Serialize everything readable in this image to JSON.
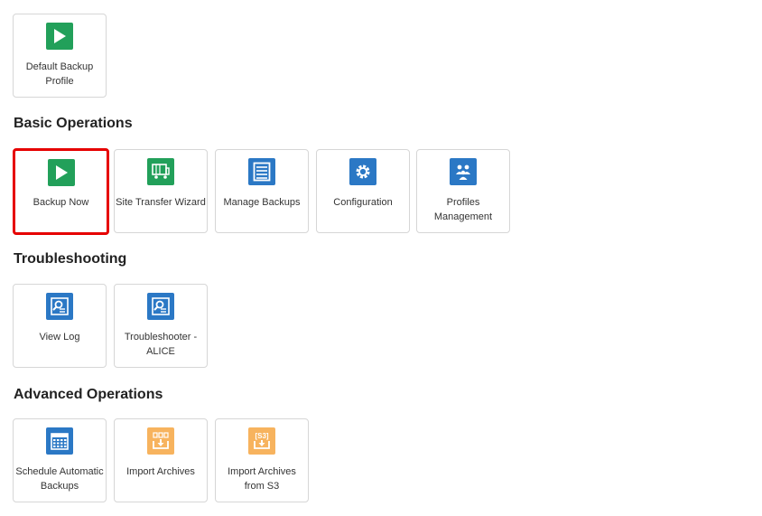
{
  "top": {
    "tiles": [
      {
        "label": "Default Backup Profile",
        "icon": "play-icon"
      }
    ]
  },
  "sections": [
    {
      "heading": "Basic Operations",
      "tiles": [
        {
          "label": "Backup Now",
          "icon": "play-icon",
          "highlighted": true
        },
        {
          "label": "Site Transfer Wizard",
          "icon": "truck-icon"
        },
        {
          "label": "Manage Backups",
          "icon": "list-icon"
        },
        {
          "label": "Configuration",
          "icon": "gear-icon"
        },
        {
          "label": "Profiles Management",
          "icon": "users-icon"
        }
      ]
    },
    {
      "heading": "Troubleshooting",
      "tiles": [
        {
          "label": "View Log",
          "icon": "log-search-icon"
        },
        {
          "label": "Troubleshooter - ALICE",
          "icon": "log-search-icon"
        }
      ]
    },
    {
      "heading": "Advanced Operations",
      "tiles": [
        {
          "label": "Schedule Automatic Backups",
          "icon": "calendar-icon"
        },
        {
          "label": "Import Archives",
          "icon": "import-icon"
        },
        {
          "label": "Import Archives from S3",
          "icon": "import-s3-icon"
        }
      ]
    }
  ],
  "colors": {
    "green": "#22a05a",
    "blue": "#2b78c5",
    "orange": "#f7b35e",
    "highlight_border": "#e60000"
  }
}
